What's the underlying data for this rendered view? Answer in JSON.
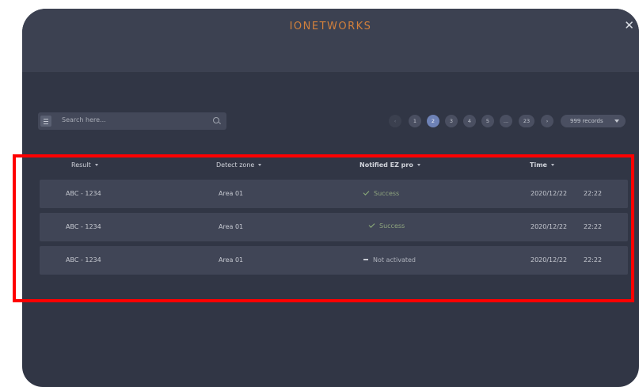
{
  "app": {
    "brand": "IONETWORKS"
  },
  "toolbar": {
    "search_placeholder": "Search here...",
    "pagination": [
      "1",
      "2",
      "3",
      "4",
      "5",
      "...",
      "23"
    ],
    "active_page": "2",
    "records_label": "999 records"
  },
  "table": {
    "columns": [
      "Result",
      "Detect zone",
      "Notified EZ pro",
      "Time"
    ],
    "rows": [
      {
        "result": "ABC - 1234",
        "zone": "Area 01",
        "status": "Success",
        "status_icon": "check-icon",
        "date": "2020/12/22",
        "time": "22:22"
      },
      {
        "result": "ABC - 1234",
        "zone": "Area 01",
        "status": "Success",
        "status_icon": "check-icon",
        "date": "2020/12/22",
        "time": "22:22"
      },
      {
        "result": "ABC - 1234",
        "zone": "Area 01",
        "status": "Not activated",
        "status_icon": "dash-icon",
        "date": "2020/12/22",
        "time": "22:22"
      }
    ]
  },
  "colors": {
    "window_bg": "#313645",
    "header_bg": "#3c4151",
    "brand": "#d2803c",
    "active_page": "#6e82b6",
    "success": "#8fb17b",
    "highlight": "#ff0000"
  }
}
